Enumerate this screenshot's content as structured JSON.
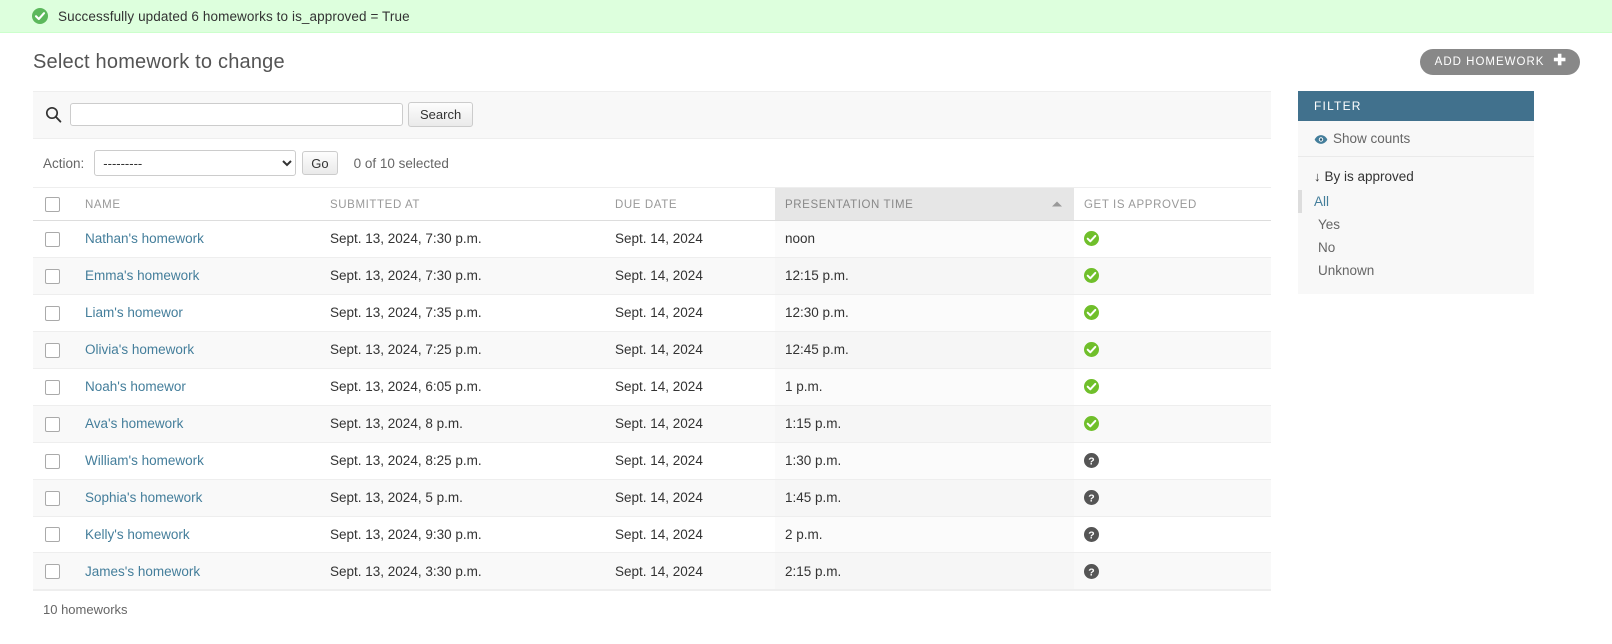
{
  "message": {
    "icon": "success-check-icon",
    "text": "Successfully updated 6 homeworks to is_approved = True",
    "bg_color": "#ddffdd"
  },
  "header": {
    "page_title": "Select homework to change",
    "add_button_label": "ADD HOMEWORK",
    "add_button_plus": "✚"
  },
  "search": {
    "icon": "search-icon",
    "value": "",
    "placeholder": "",
    "button_label": "Search"
  },
  "actions": {
    "label": "Action:",
    "selected_option": "---------",
    "options": [
      "---------"
    ],
    "go_label": "Go",
    "counter": "0 of 10 selected"
  },
  "table": {
    "columns": [
      {
        "key": "checkbox",
        "label": ""
      },
      {
        "key": "name",
        "label": "NAME"
      },
      {
        "key": "submitted_at",
        "label": "SUBMITTED AT"
      },
      {
        "key": "due_date",
        "label": "DUE DATE"
      },
      {
        "key": "presentation_time",
        "label": "PRESENTATION TIME",
        "sorted": "asc"
      },
      {
        "key": "get_is_approved",
        "label": "GET IS APPROVED"
      }
    ],
    "rows": [
      {
        "name": "Nathan's homework",
        "submitted_at": "Sept. 13, 2024, 7:30 p.m.",
        "due_date": "Sept. 14, 2024",
        "presentation_time": "noon",
        "get_is_approved": "yes"
      },
      {
        "name": "Emma's homework",
        "submitted_at": "Sept. 13, 2024, 7:30 p.m.",
        "due_date": "Sept. 14, 2024",
        "presentation_time": "12:15 p.m.",
        "get_is_approved": "yes"
      },
      {
        "name": "Liam's homewor",
        "submitted_at": "Sept. 13, 2024, 7:35 p.m.",
        "due_date": "Sept. 14, 2024",
        "presentation_time": "12:30 p.m.",
        "get_is_approved": "yes"
      },
      {
        "name": "Olivia's homework",
        "submitted_at": "Sept. 13, 2024, 7:25 p.m.",
        "due_date": "Sept. 14, 2024",
        "presentation_time": "12:45 p.m.",
        "get_is_approved": "yes"
      },
      {
        "name": "Noah's homewor",
        "submitted_at": "Sept. 13, 2024, 6:05 p.m.",
        "due_date": "Sept. 14, 2024",
        "presentation_time": "1 p.m.",
        "get_is_approved": "yes"
      },
      {
        "name": "Ava's homework",
        "submitted_at": "Sept. 13, 2024, 8 p.m.",
        "due_date": "Sept. 14, 2024",
        "presentation_time": "1:15 p.m.",
        "get_is_approved": "yes"
      },
      {
        "name": "William's homework",
        "submitted_at": "Sept. 13, 2024, 8:25 p.m.",
        "due_date": "Sept. 14, 2024",
        "presentation_time": "1:30 p.m.",
        "get_is_approved": "unknown"
      },
      {
        "name": "Sophia's homework",
        "submitted_at": "Sept. 13, 2024, 5 p.m.",
        "due_date": "Sept. 14, 2024",
        "presentation_time": "1:45 p.m.",
        "get_is_approved": "unknown"
      },
      {
        "name": "Kelly's homework",
        "submitted_at": "Sept. 13, 2024, 9:30 p.m.",
        "due_date": "Sept. 14, 2024",
        "presentation_time": "2 p.m.",
        "get_is_approved": "unknown"
      },
      {
        "name": "James's homework",
        "submitted_at": "Sept. 13, 2024, 3:30 p.m.",
        "due_date": "Sept. 14, 2024",
        "presentation_time": "2:15 p.m.",
        "get_is_approved": "unknown"
      }
    ]
  },
  "paginator": {
    "text": "10 homeworks"
  },
  "filter": {
    "title": "FILTER",
    "header_color": "#41718d",
    "show_counts_label": "Show counts",
    "show_counts_icon": "eye-icon",
    "groups": [
      {
        "title": "By is approved",
        "arrow": "↓",
        "choices": [
          {
            "label": "All",
            "selected": true
          },
          {
            "label": "Yes",
            "selected": false
          },
          {
            "label": "No",
            "selected": false
          },
          {
            "label": "Unknown",
            "selected": false
          }
        ]
      }
    ]
  },
  "colors": {
    "link": "#447e9b",
    "boolean_yes": "#70bf2b",
    "boolean_unknown": "#555555"
  }
}
